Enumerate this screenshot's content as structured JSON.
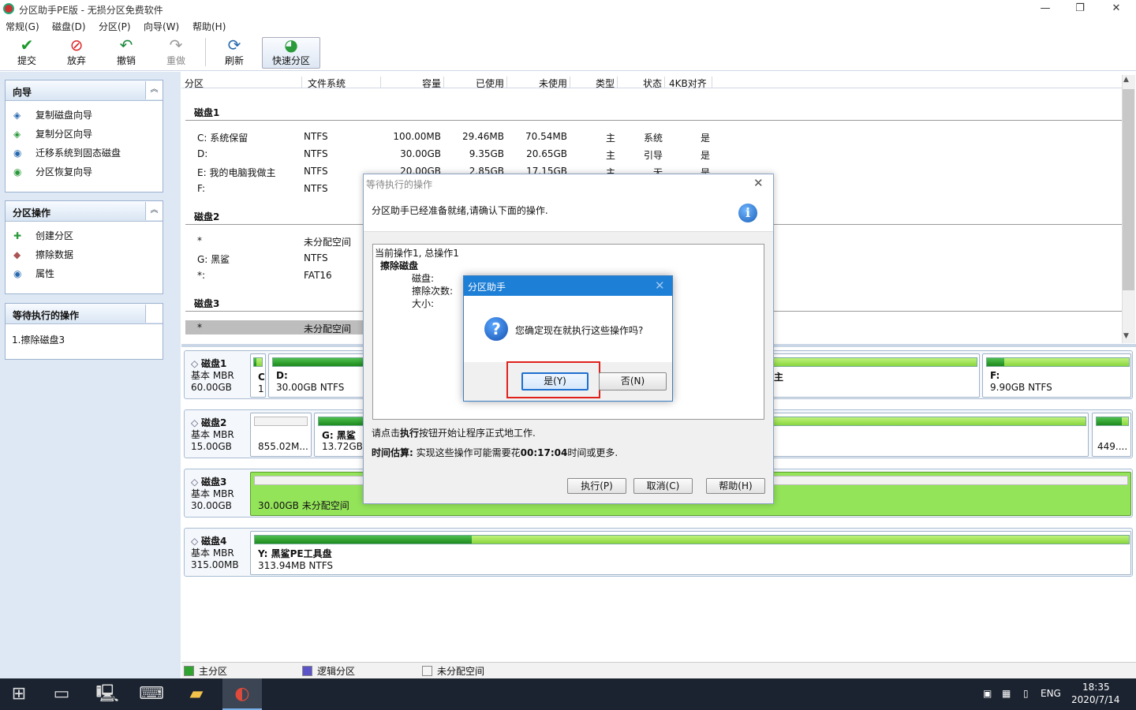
{
  "window": {
    "title": "分区助手PE版 - 无损分区免费软件",
    "controls": [
      "—",
      "❐",
      "✕"
    ]
  },
  "menu": [
    "常规(G)",
    "磁盘(D)",
    "分区(P)",
    "向导(W)",
    "帮助(H)"
  ],
  "toolbar": {
    "submit": "提交",
    "discard": "放弃",
    "undo": "撤销",
    "redo": "重做",
    "refresh": "刷新",
    "quick": "快速分区"
  },
  "left": {
    "wizard": {
      "title": "向导",
      "items": [
        "复制磁盘向导",
        "复制分区向导",
        "迁移系统到固态磁盘",
        "分区恢复向导"
      ]
    },
    "partops": {
      "title": "分区操作",
      "items": [
        "创建分区",
        "擦除数据",
        "属性"
      ]
    },
    "pending": {
      "title": "等待执行的操作",
      "items": [
        "1.擦除磁盘3"
      ]
    },
    "collapse": "≈"
  },
  "table": {
    "headers": [
      "分区",
      "文件系统",
      "容量",
      "已使用",
      "未使用",
      "类型",
      "状态",
      "4KB对齐"
    ],
    "disk1": {
      "title": "磁盘1",
      "rows": [
        [
          "C: 系统保留",
          "NTFS",
          "100.00MB",
          "29.46MB",
          "70.54MB",
          "主",
          "系统",
          "是"
        ],
        [
          "D:",
          "NTFS",
          "30.00GB",
          "9.35GB",
          "20.65GB",
          "主",
          "引导",
          "是"
        ],
        [
          "E: 我的电脑我做主",
          "NTFS",
          "20.00GB",
          "2.85GB",
          "17.15GB",
          "主",
          "无",
          "是"
        ],
        [
          "F:",
          "NTFS"
        ]
      ]
    },
    "disk2": {
      "title": "磁盘2",
      "rows": [
        [
          "*",
          "未分配空间"
        ],
        [
          "G: 黑鲨",
          "NTFS"
        ],
        [
          "*:",
          "FAT16"
        ]
      ]
    },
    "disk3": {
      "title": "磁盘3",
      "rows": [
        [
          "*",
          "未分配空间"
        ]
      ]
    }
  },
  "diskmap": [
    {
      "name": "磁盘1",
      "type": "基本 MBR",
      "size": "60.00GB",
      "parts": {
        "c1": "C",
        "c2": "1",
        "d1": "D:",
        "d2": "30.00GB NTFS",
        "e": "主",
        "f1": "F:",
        "f2": "9.90GB NTFS"
      }
    },
    {
      "name": "磁盘2",
      "type": "基本 MBR",
      "size": "15.00GB",
      "parts": {
        "u": "855.02M...",
        "g1": "G: 黑鲨",
        "g2": "13.72GB",
        "l": "449...."
      }
    },
    {
      "name": "磁盘3",
      "type": "基本 MBR",
      "size": "30.00GB",
      "parts": {
        "u": "30.00GB 未分配空间"
      }
    },
    {
      "name": "磁盘4",
      "type": "基本 MBR",
      "size": "315.00MB",
      "parts": {
        "y1": "Y: 黑鲨PE工具盘",
        "y2": "313.94MB NTFS"
      }
    }
  ],
  "legend": {
    "primary": "主分区",
    "logical": "逻辑分区",
    "unalloc": "未分配空间"
  },
  "pending_dialog": {
    "title": "等待执行的操作",
    "banner": "分区助手已经准备就绪,请确认下面的操作.",
    "list": {
      "l1": "当前操作1, 总操作1",
      "l2": "擦除磁盘",
      "l3": "磁盘:",
      "l4": "擦除次数:",
      "l5": "大小:"
    },
    "note1a": "请点击",
    "note1b": "执行",
    "note1c": "按钮开始让程序正式地工作.",
    "note2a": "时间估算:",
    "note2b": " 实现这些操作可能需要花",
    "note2c": "00:17:04",
    "note2d": "时间或更多.",
    "exec": "执行(P)",
    "cancel": "取消(C)",
    "help": "帮助(H)"
  },
  "confirm": {
    "title": "分区助手",
    "message": "您确定现在就执行这些操作吗?",
    "yes": "是(Y)",
    "no": "否(N)"
  },
  "tray": {
    "lang": "ENG",
    "time": "18:35",
    "date": "2020/7/14"
  },
  "colors": {
    "accent": "#1e7fd6",
    "primary_part": "#2fa52f",
    "unalloc_fill": "#94e45a",
    "highlight": "#e0211b"
  }
}
